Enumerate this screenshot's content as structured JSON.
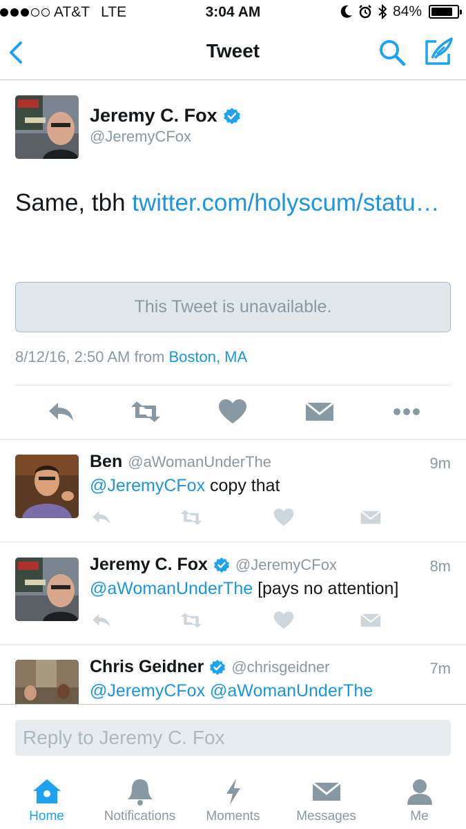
{
  "status_bar": {
    "carrier": "AT&T",
    "network": "LTE",
    "time": "3:04 AM",
    "battery": "84%",
    "battery_level": 0.84,
    "signal_bars": 3
  },
  "nav": {
    "title": "Tweet"
  },
  "tweet": {
    "name": "Jeremy C. Fox",
    "handle": "@JeremyCFox",
    "text": "Same, tbh ",
    "link": "twitter.com/holyscum/statu…",
    "quoted_unavailable": "This Tweet is unavailable.",
    "timestamp": "8/12/16, 2:50 AM from",
    "location": "Boston, MA"
  },
  "replies": [
    {
      "name": "Ben",
      "handle": "@aWomanUnderThe",
      "time": "9m",
      "mention": "@JeremyCFox",
      "text": " copy that",
      "verified": false
    },
    {
      "name": "Jeremy C. Fox",
      "handle": "@JeremyCFox",
      "time": "8m",
      "mention": "@aWomanUnderThe",
      "text": " [pays no attention]",
      "verified": true
    },
    {
      "name": "Chris Geidner",
      "handle": "@chrisgeidner",
      "time": "7m",
      "mention": "@JeremyCFox @aWomanUnderThe",
      "text": "",
      "verified": true
    }
  ],
  "reply_bar": {
    "placeholder": "Reply to Jeremy C. Fox"
  },
  "tabs": [
    {
      "label": "Home",
      "active": true
    },
    {
      "label": "Notifications",
      "active": false
    },
    {
      "label": "Moments",
      "active": false
    },
    {
      "label": "Messages",
      "active": false
    },
    {
      "label": "Me",
      "active": false
    }
  ],
  "colors": {
    "accent": "#1da1f2",
    "link": "#1b95e0",
    "muted": "#8899a6",
    "verified": "#1da1f2"
  }
}
